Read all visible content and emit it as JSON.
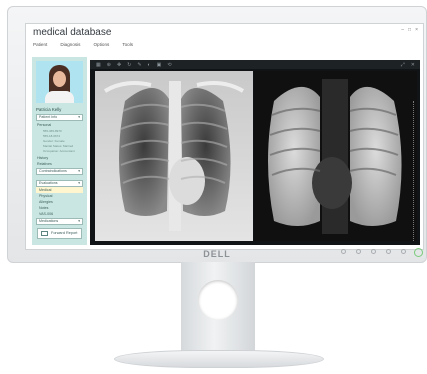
{
  "app": {
    "title": "medical database",
    "menu": [
      "Patient",
      "Diagnosis",
      "Options",
      "Tools"
    ],
    "window_controls": [
      "–",
      "□",
      "×"
    ]
  },
  "sidebar": {
    "patient_name": "Patricia Kelly",
    "patient_info_label": "Patient Info",
    "personal_heading": "Personal",
    "personal_lines": [
      "555-365-8970",
      "555-18-6674",
      "Gender: Female",
      "Marital Status: Married",
      "Occupation: Accountant"
    ],
    "history_label": "History",
    "relatives_label": "Relatives",
    "contraindications_label": "Contraindications",
    "evaluations_label": "Evaluations",
    "evaluation_items": [
      {
        "label": "Medical",
        "active": true
      },
      {
        "label": "Physical",
        "active": false
      },
      {
        "label": "Allergies",
        "active": false
      },
      {
        "label": "Notes",
        "active": false
      },
      {
        "label": "VAS-006",
        "active": false
      }
    ],
    "medications_label": "Medications",
    "forward_report_label": "Forward Report"
  },
  "viewer": {
    "toolbar_icons": [
      "grid-icon",
      "zoom-icon",
      "pan-icon",
      "rotate-icon",
      "measure-icon",
      "contrast-icon",
      "invert-icon",
      "reset-icon"
    ],
    "toolbar_glyphs": [
      "▦",
      "⊕",
      "✥",
      "↻",
      "✎",
      "◐",
      "▣",
      "⟲"
    ],
    "right_controls": [
      "⤢",
      "✕"
    ]
  },
  "monitor": {
    "brand": "DELL"
  }
}
